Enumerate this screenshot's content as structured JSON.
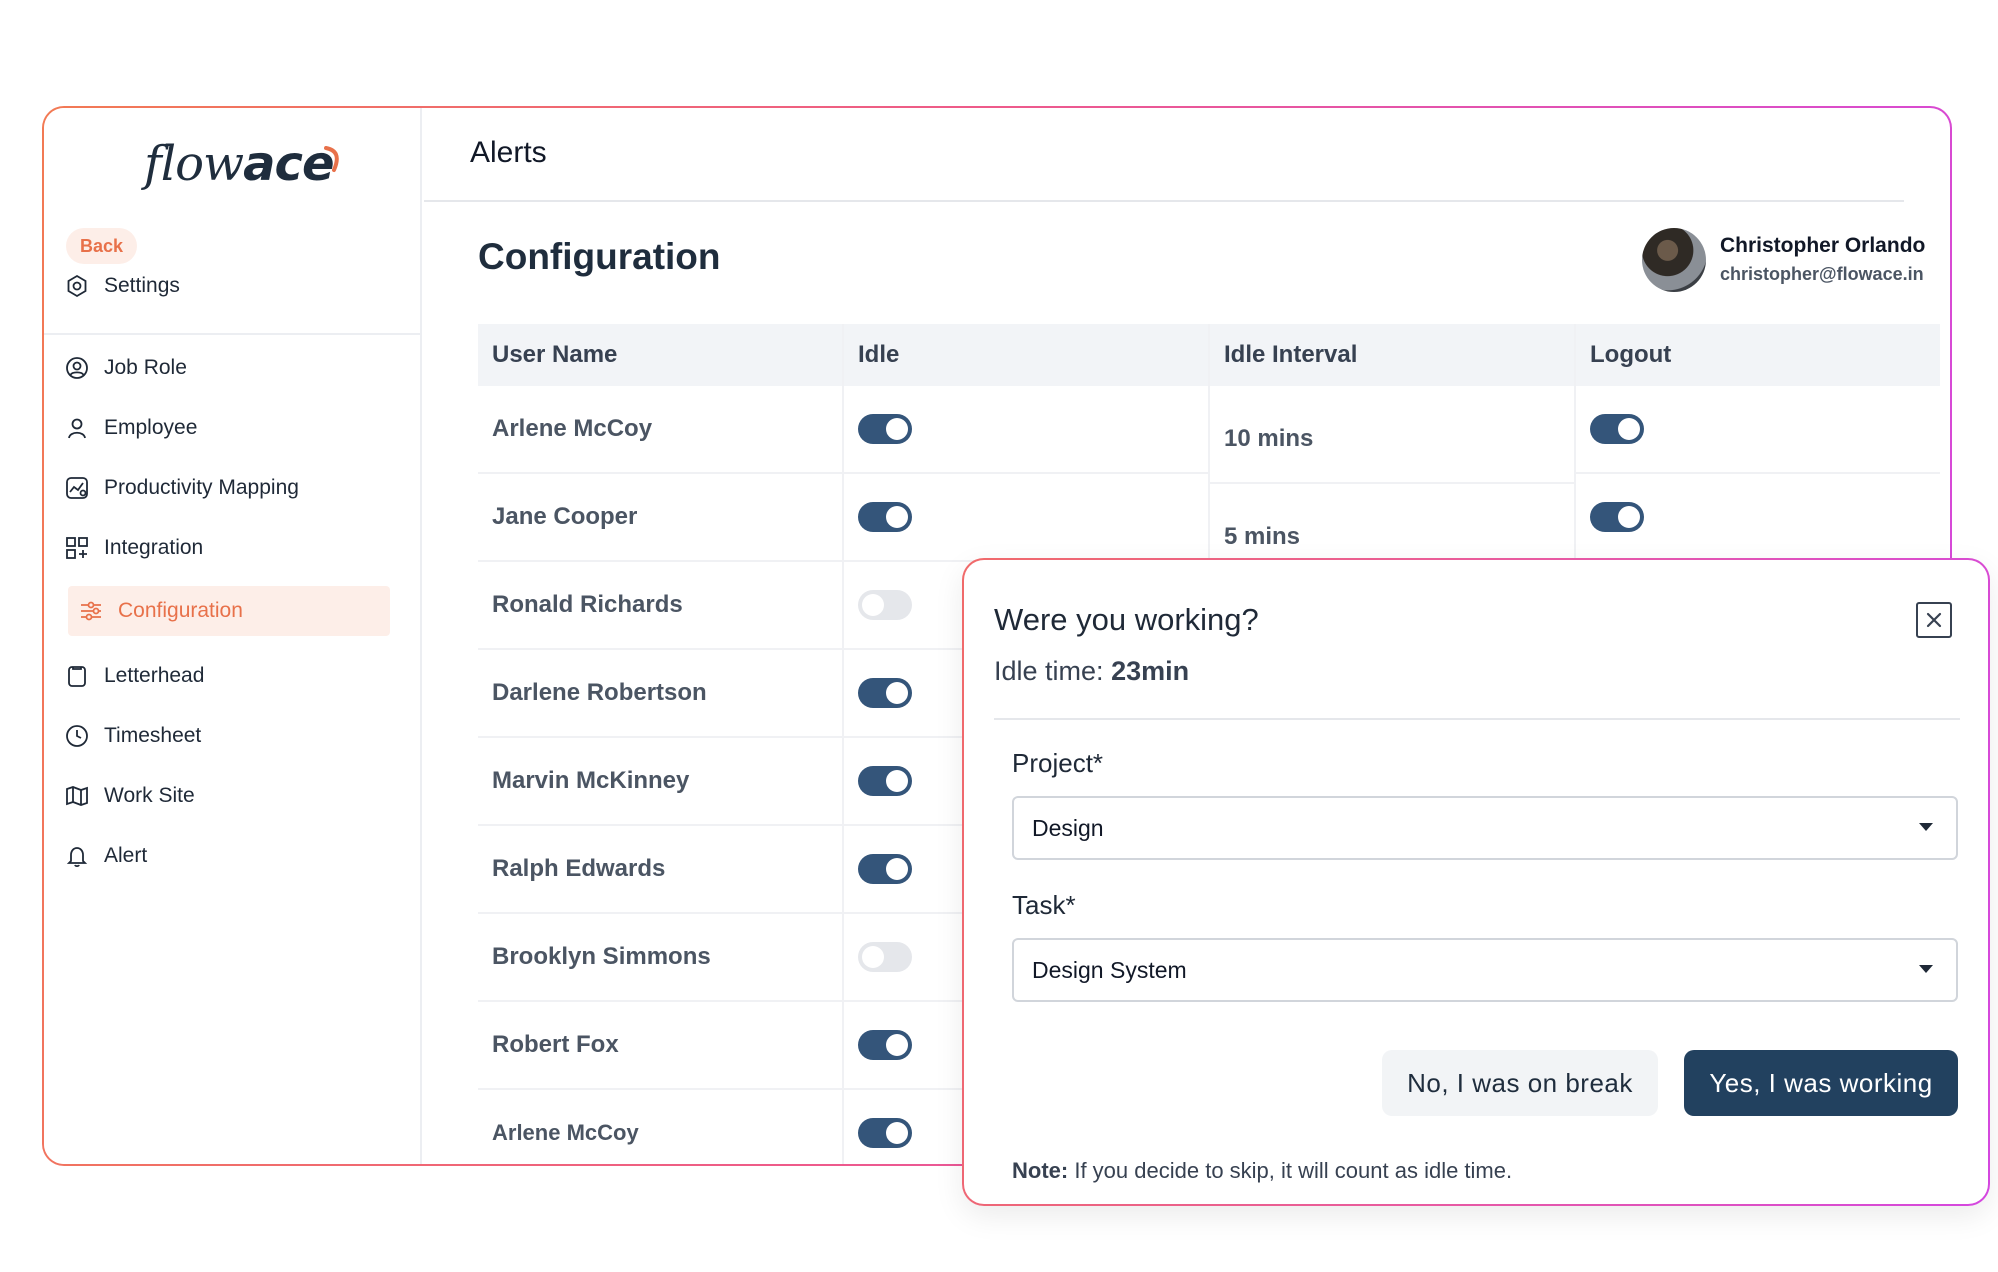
{
  "brand": {
    "logo_light": "flow",
    "logo_bold": "ace"
  },
  "sidebar": {
    "back_label": "Back",
    "items": [
      {
        "label": "Settings",
        "icon": "settings-icon"
      },
      {
        "label": "Job Role",
        "icon": "user-circle-icon"
      },
      {
        "label": "Employee",
        "icon": "user-icon"
      },
      {
        "label": "Productivity Mapping",
        "icon": "chart-icon"
      },
      {
        "label": "Integration",
        "icon": "grid-plus-icon"
      },
      {
        "label": "Configuration",
        "icon": "sliders-icon",
        "active": true
      },
      {
        "label": "Letterhead",
        "icon": "clipboard-icon"
      },
      {
        "label": "Timesheet",
        "icon": "clock-icon"
      },
      {
        "label": "Work Site",
        "icon": "map-icon"
      },
      {
        "label": "Alert",
        "icon": "bell-icon"
      }
    ]
  },
  "header": {
    "title": "Alerts"
  },
  "page": {
    "title": "Configuration"
  },
  "user": {
    "name": "Christopher Orlando",
    "email": "christopher@flowace.in"
  },
  "table": {
    "columns": [
      "User Name",
      "Idle",
      "Idle Interval",
      "Logout"
    ],
    "rows": [
      {
        "name": "Arlene McCoy",
        "idle": true,
        "logout": true
      },
      {
        "name": "Jane Cooper",
        "idle": true,
        "logout": true
      },
      {
        "name": "Ronald Richards",
        "idle": false
      },
      {
        "name": "Darlene Robertson",
        "idle": true
      },
      {
        "name": "Marvin McKinney",
        "idle": true
      },
      {
        "name": "Ralph Edwards",
        "idle": true
      },
      {
        "name": "Brooklyn Simmons",
        "idle": false
      },
      {
        "name": "Robert Fox",
        "idle": true
      },
      {
        "name": "Arlene McCoy",
        "idle": true
      }
    ],
    "intervals": [
      "10 mins",
      "5 mins"
    ]
  },
  "modal": {
    "title": "Were you working?",
    "idle_label": "Idle time:",
    "idle_value": "23min",
    "project_label": "Project*",
    "project_value": "Design",
    "task_label": "Task*",
    "task_value": "Design System",
    "no_button": "No, I was on break",
    "yes_button": "Yes, I was working",
    "note_label": "Note:",
    "note_text": "If you decide to skip, it will count as idle time."
  },
  "colors": {
    "accent": "#e8714a",
    "primary": "#22415f",
    "toggle_on": "#34557a"
  }
}
